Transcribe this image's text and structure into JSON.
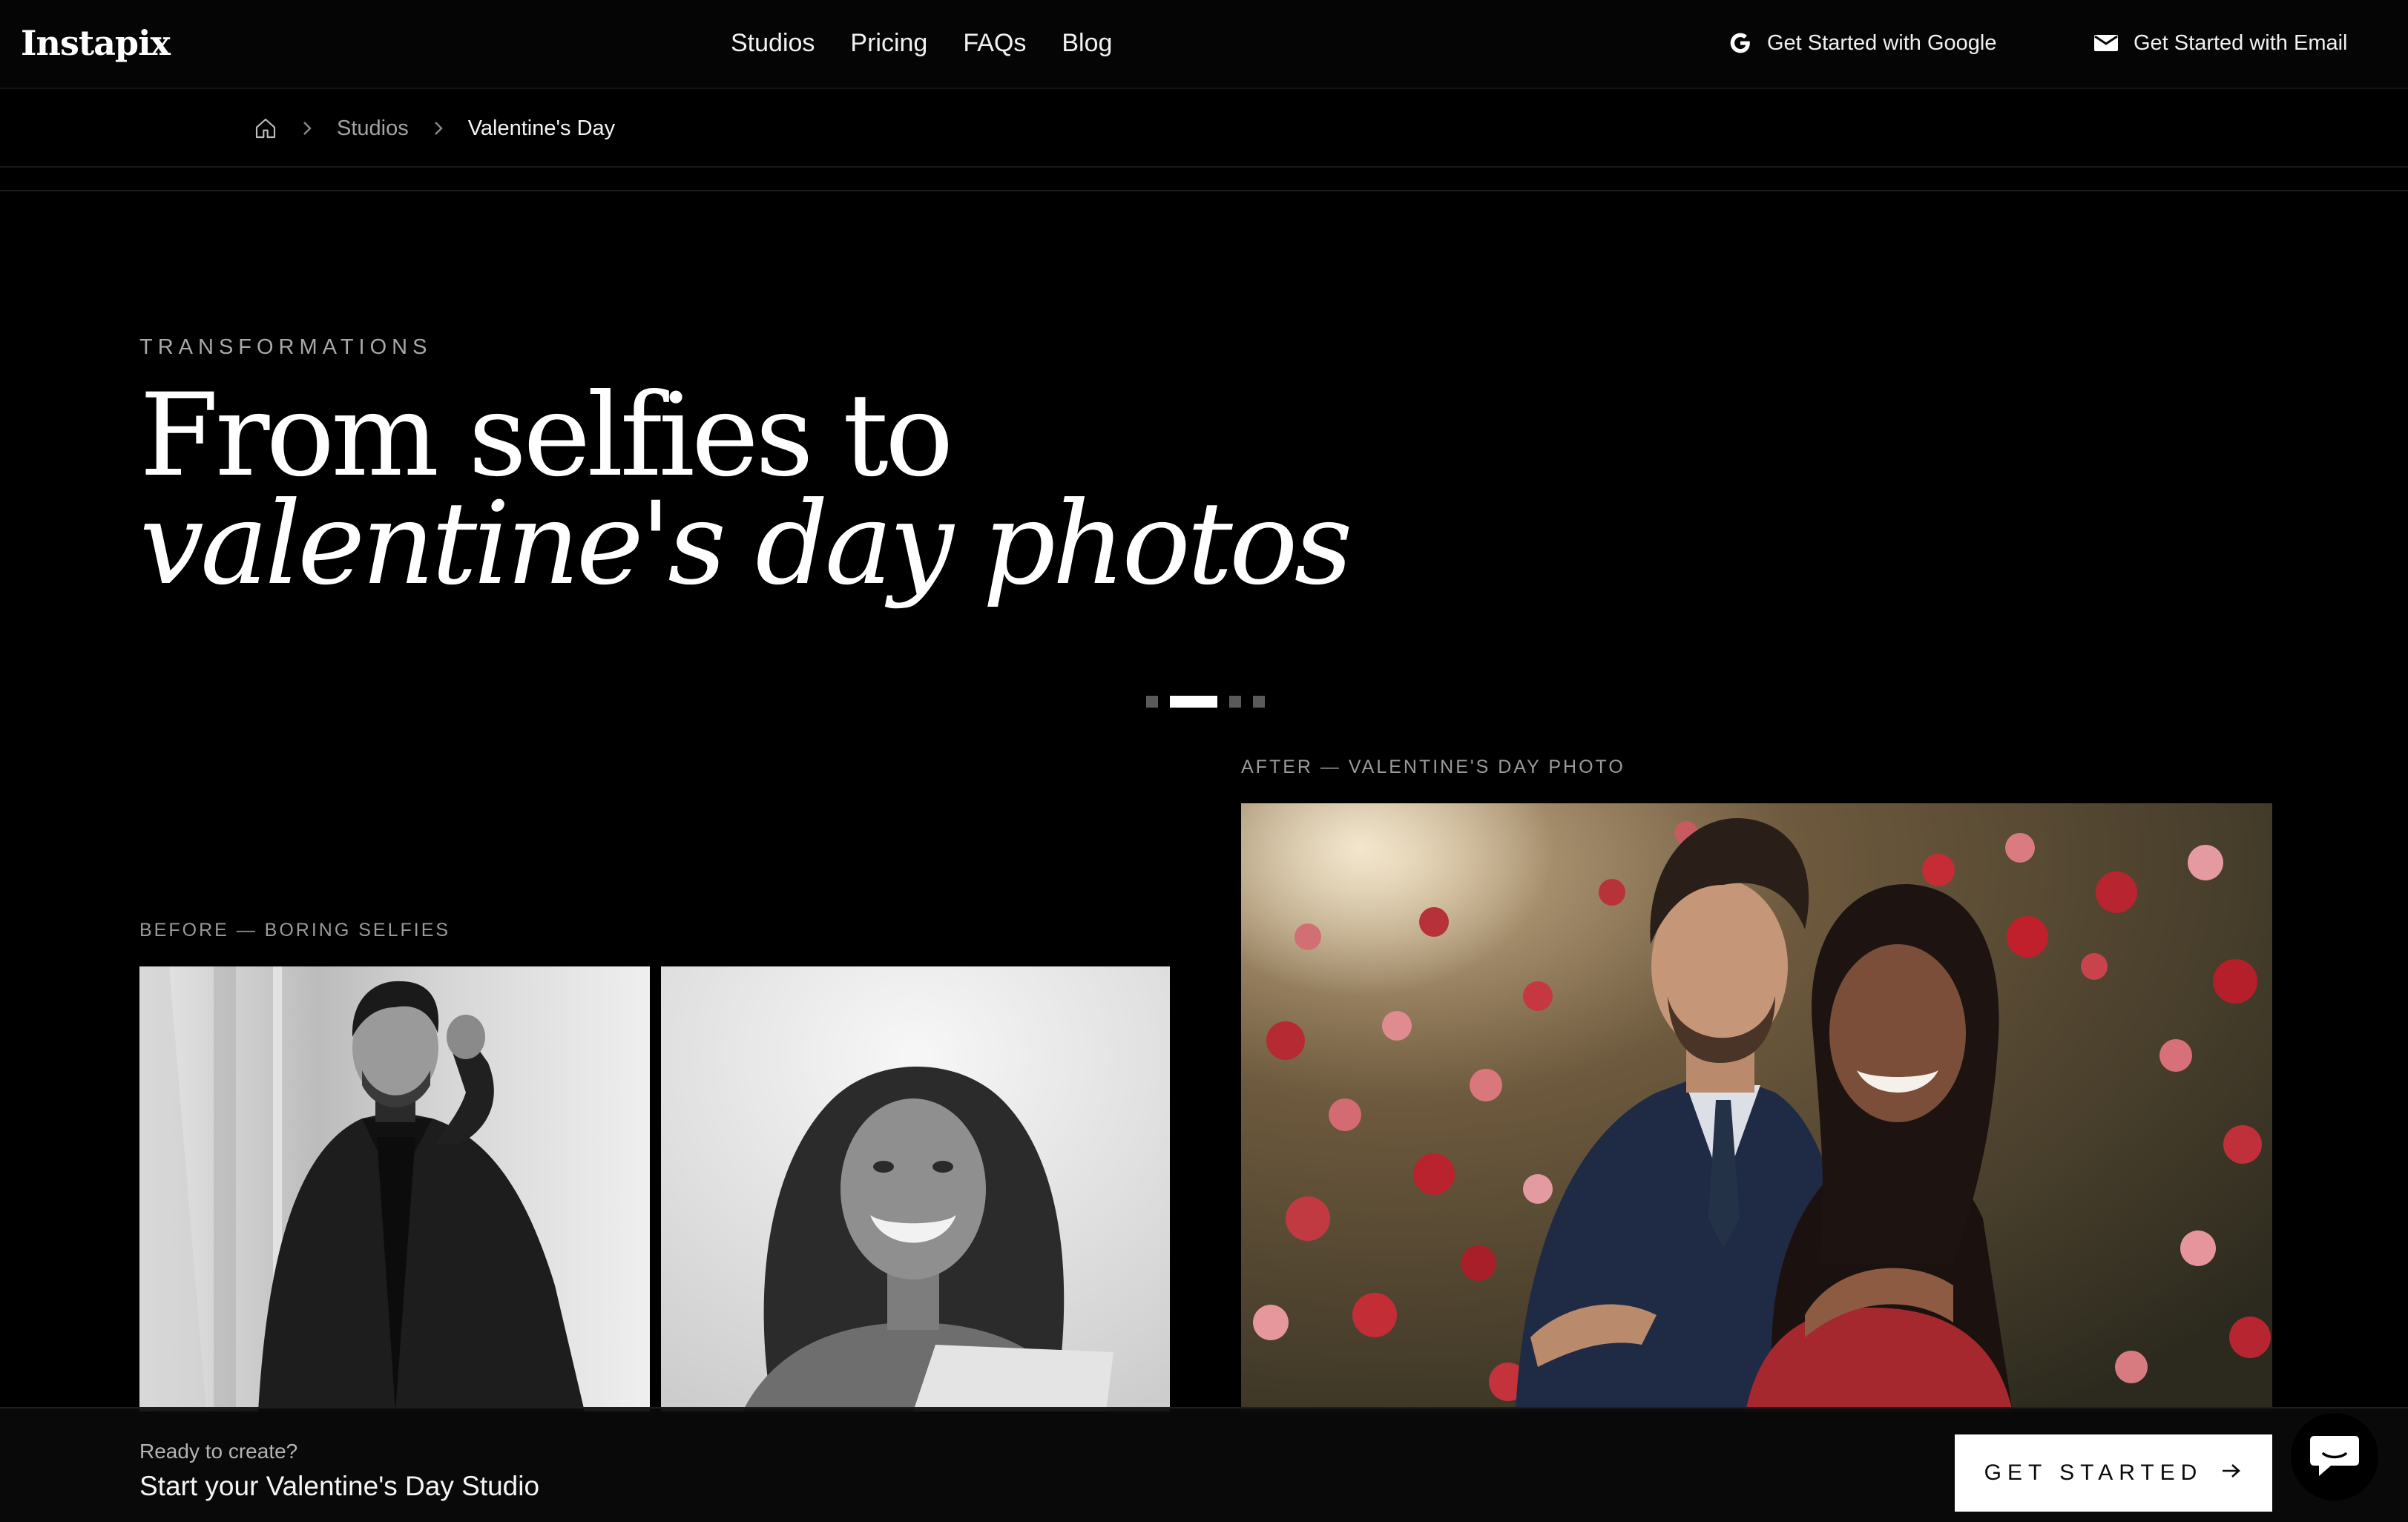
{
  "header": {
    "logo": "Instapix",
    "nav": [
      "Studios",
      "Pricing",
      "FAQs",
      "Blog"
    ],
    "google_label": "Get Started with Google",
    "email_label": "Get Started with Email"
  },
  "breadcrumb": {
    "items": [
      "Studios",
      "Valentine's Day"
    ]
  },
  "hero": {
    "eyebrow": "TRANSFORMATIONS",
    "line1": "From selfies to",
    "line2": "valentine's day photos"
  },
  "carousel": {
    "slide_count": 4,
    "active_index": 1
  },
  "comparison": {
    "before_label": "BEFORE — BORING SELFIES",
    "after_label": "AFTER — VALENTINE'S DAY PHOTO"
  },
  "cta": {
    "kicker": "Ready to create?",
    "title": "Start your Valentine's Day Studio",
    "button": "GET STARTED"
  },
  "colors": {
    "background": "#000000",
    "text": "#ffffff",
    "muted": "#9a9a9a",
    "rose": "#b82a35"
  },
  "icons": [
    "google-icon",
    "mail-icon",
    "home-icon",
    "chevron-right-icon",
    "arrow-right-icon",
    "chat-icon"
  ]
}
